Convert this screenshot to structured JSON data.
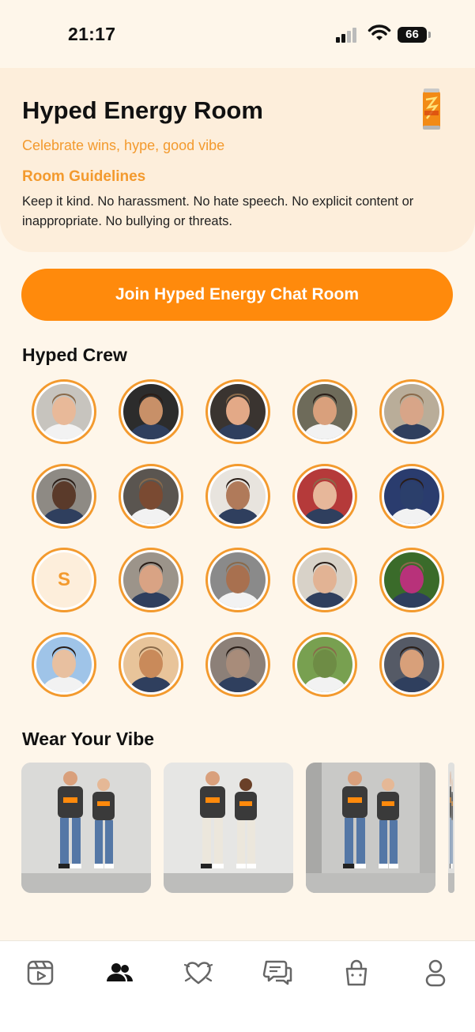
{
  "status_bar": {
    "time": "21:17",
    "battery": "66"
  },
  "room": {
    "title": "Hyped Energy Room",
    "subtitle": "Celebrate wins, hype, good vibe",
    "guidelines_title": "Room Guidelines",
    "guidelines_text": "Keep it kind. No harassment. No hate speech. No explicit content or inappropriate. No bullying or threats.",
    "icon": "energy-drink-can-icon"
  },
  "join_button": {
    "label": "Join Hyped Energy Chat Room"
  },
  "crew": {
    "title": "Hyped Crew",
    "members": [
      {
        "type": "photo",
        "name": "member-1"
      },
      {
        "type": "photo",
        "name": "member-2"
      },
      {
        "type": "photo",
        "name": "member-3"
      },
      {
        "type": "photo",
        "name": "member-4"
      },
      {
        "type": "photo",
        "name": "member-5"
      },
      {
        "type": "photo",
        "name": "member-6"
      },
      {
        "type": "photo",
        "name": "member-7"
      },
      {
        "type": "photo",
        "name": "member-8"
      },
      {
        "type": "photo",
        "name": "member-9"
      },
      {
        "type": "photo",
        "name": "member-10"
      },
      {
        "type": "initial",
        "initial": "S",
        "name": "member-11"
      },
      {
        "type": "photo",
        "name": "member-12"
      },
      {
        "type": "photo",
        "name": "member-13"
      },
      {
        "type": "photo",
        "name": "member-14"
      },
      {
        "type": "photo",
        "name": "member-15"
      },
      {
        "type": "photo",
        "name": "member-16"
      },
      {
        "type": "photo",
        "name": "member-17"
      },
      {
        "type": "photo",
        "name": "member-18"
      },
      {
        "type": "photo",
        "name": "member-19"
      },
      {
        "type": "photo",
        "name": "member-20"
      }
    ]
  },
  "merch": {
    "title": "Wear Your Vibe",
    "items": [
      {
        "name": "merch-item-1"
      },
      {
        "name": "merch-item-2"
      },
      {
        "name": "merch-item-3"
      },
      {
        "name": "merch-item-4"
      }
    ]
  },
  "bottom_nav": {
    "items": [
      {
        "icon": "video-icon",
        "active": false
      },
      {
        "icon": "people-icon",
        "active": true
      },
      {
        "icon": "heart-icon",
        "active": false
      },
      {
        "icon": "chat-icon",
        "active": false
      },
      {
        "icon": "shopping-bag-icon",
        "active": false
      },
      {
        "icon": "profile-icon",
        "active": false
      }
    ]
  },
  "colors": {
    "accent": "#FF8A0C",
    "accent_text": "#F39A2E",
    "background": "#FEF6EA",
    "header_bg": "#FDEEDB"
  }
}
